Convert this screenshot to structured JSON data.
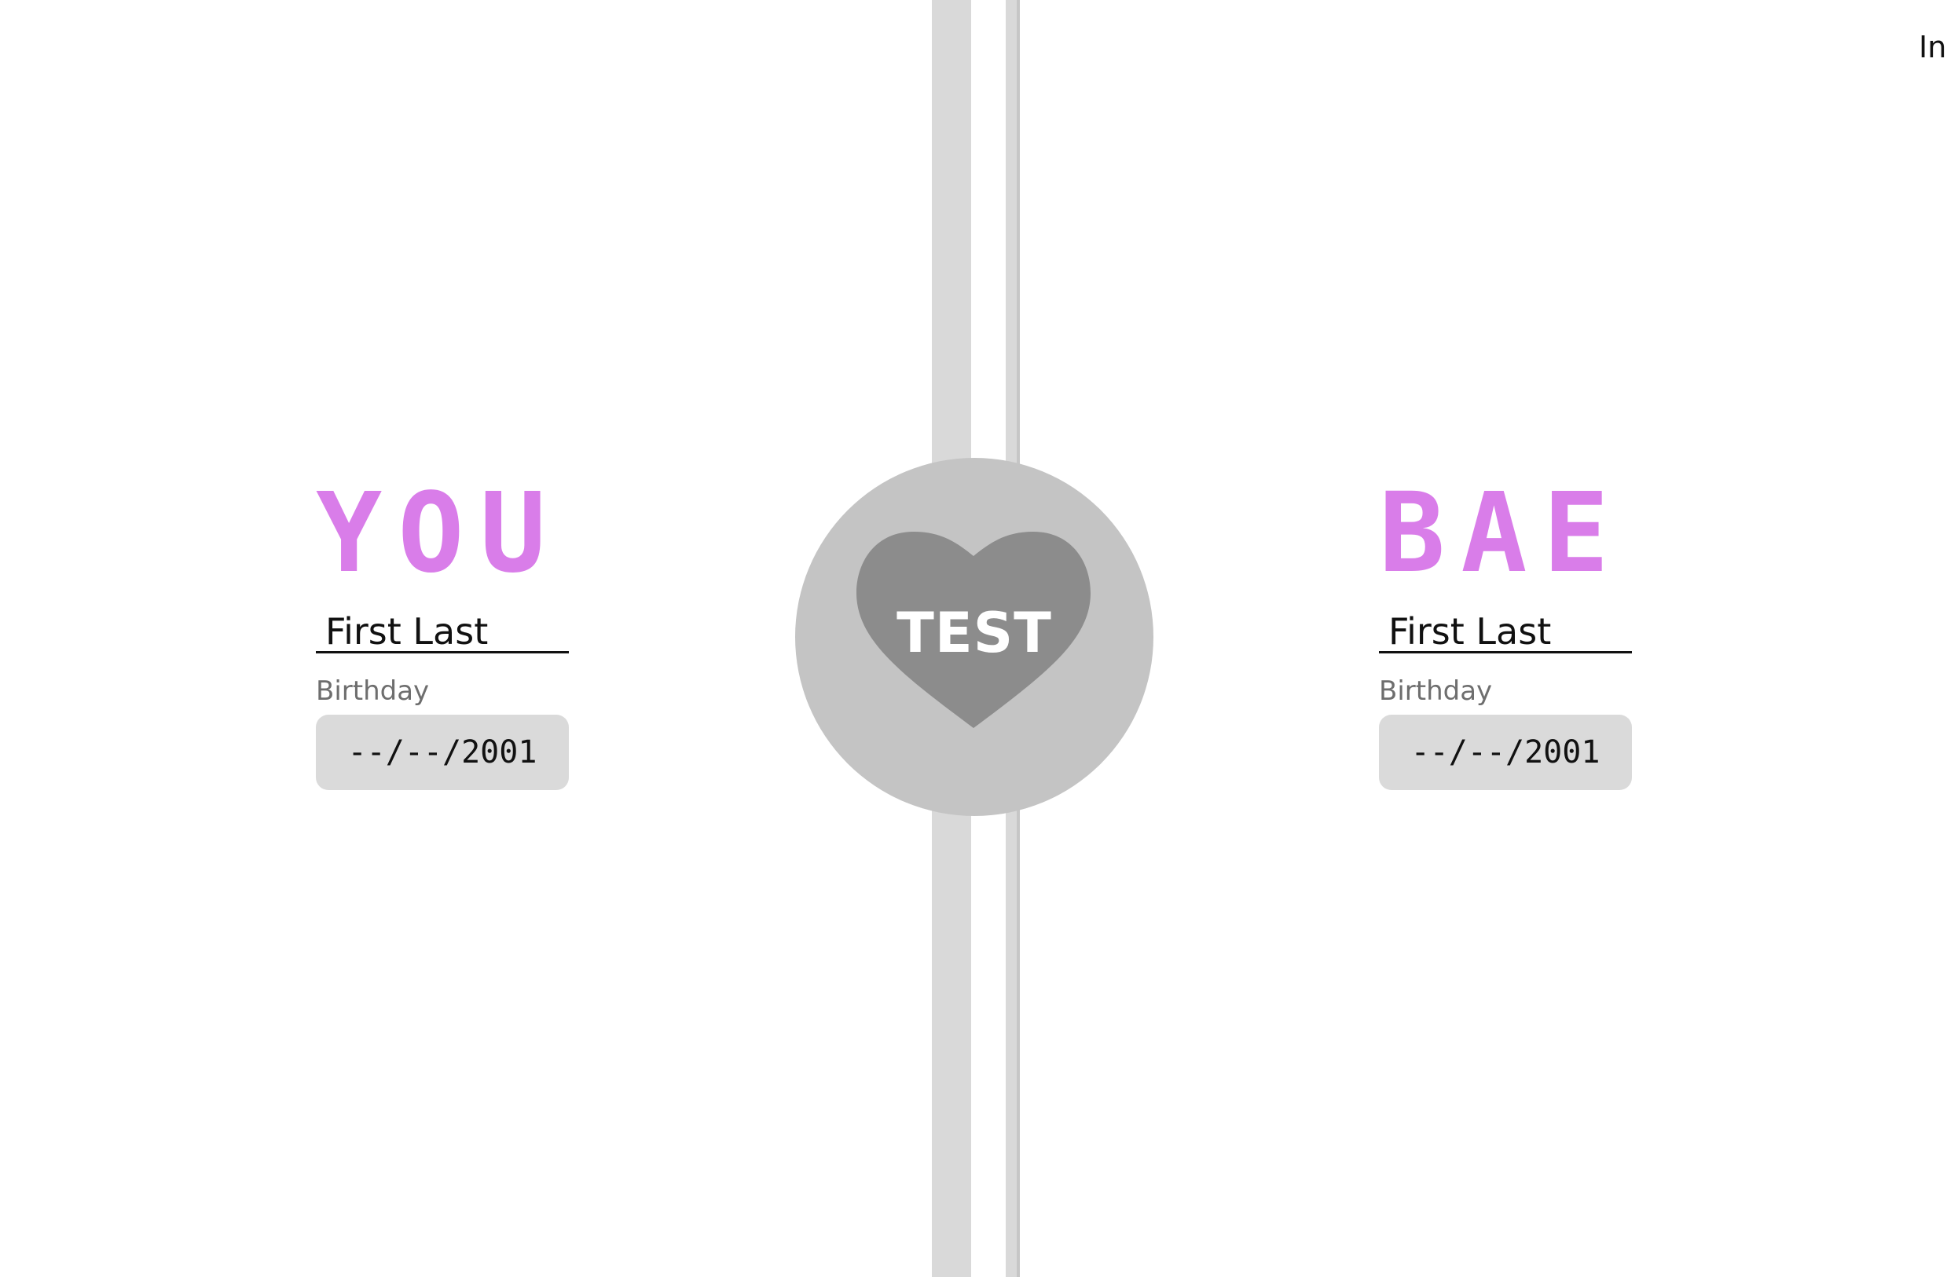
{
  "top_right_fragment": "In",
  "center": {
    "button_label": "TEST",
    "circle_color": "#c4c4c4",
    "heart_color": "#8c8c8c",
    "heart_icon": "heart-icon"
  },
  "you": {
    "title": "YOU",
    "name_placeholder": "First Last",
    "birthday_label": "Birthday",
    "date_placeholder": "--/--/2001"
  },
  "bae": {
    "title": "BAE",
    "name_placeholder": "First Last",
    "birthday_label": "Birthday",
    "date_placeholder": "--/--/2001"
  },
  "colors": {
    "accent": "#d97de9",
    "divider": "#d9d9d9",
    "input_bg": "#dadada",
    "label_text": "#6e6e6e"
  }
}
